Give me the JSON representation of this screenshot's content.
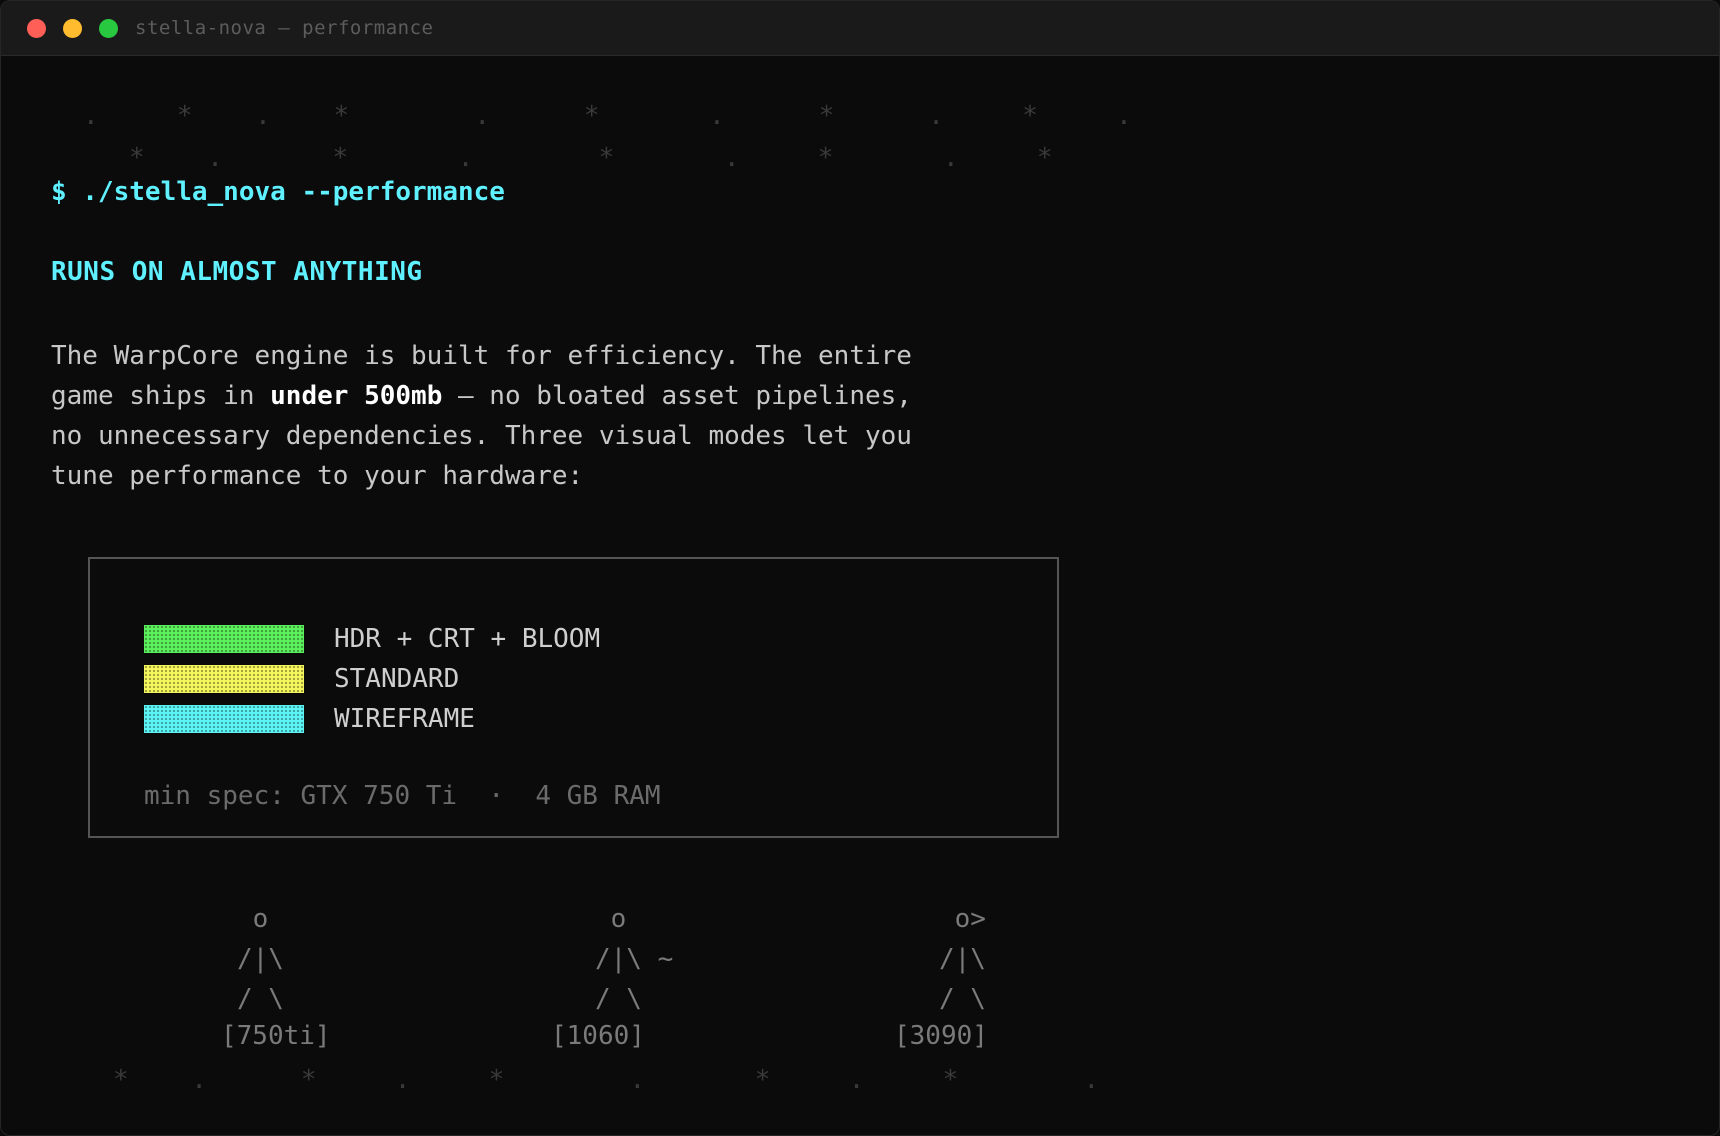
{
  "window": {
    "title": "stella-nova — performance"
  },
  "decor": {
    "stars_top_1": ".     *    .    *        .      *       .      *      .     *     .",
    "stars_top_2": "*    .       *       .        *       .     *       .     *",
    "stars_bottom": "*    .      *     .     *        .       *     .     *        ."
  },
  "terminal": {
    "prompt": "$ ./stella_nova --performance",
    "heading": "RUNS ON ALMOST ANYTHING",
    "para_part1": "The WarpCore engine is built for efficiency. The entire\ngame ships in ",
    "para_emphasis": "under 500mb",
    "para_part2": " — no bloated asset pipelines,\nno unnecessary dependencies. Three visual modes let you\ntune performance to your hardware:"
  },
  "modes": [
    {
      "label": "HDR + CRT + BLOOM",
      "color": "#5cf25c"
    },
    {
      "label": "STANDARD",
      "color": "#f5f55c"
    },
    {
      "label": "WIREFRAME",
      "color": "#5cf5f5"
    }
  ],
  "min_spec": "min spec: GTX 750 Ti  ·  4 GB RAM",
  "figures": [
    {
      "art": " o \n/|\\\n/ \\",
      "label": "[750ti]"
    },
    {
      "art": " o   \n/|\\ ~\n/ \\  ",
      "label": "[1060]"
    },
    {
      "art": " o>\n/|\\\n/ \\",
      "label": "[3090]"
    }
  ]
}
